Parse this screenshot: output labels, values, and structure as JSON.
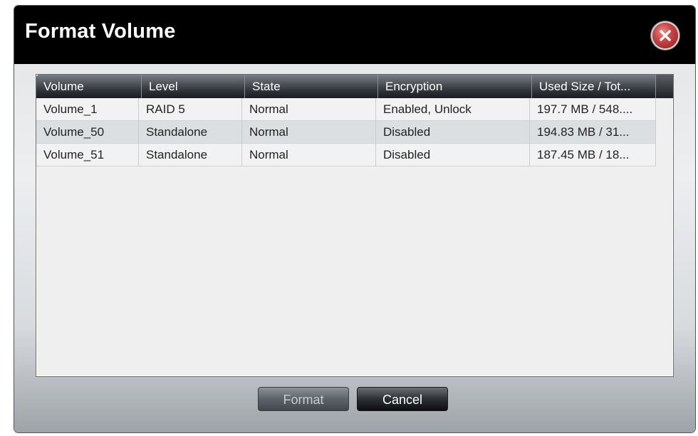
{
  "dialog": {
    "title": "Format Volume",
    "close_icon": "close-x-icon"
  },
  "table": {
    "columns": [
      "Volume",
      "Level",
      "State",
      "Encryption",
      "Used Size / Tot..."
    ],
    "rows": [
      [
        "Volume_1",
        "RAID 5",
        "Normal",
        "Enabled, Unlock",
        "197.7 MB / 548...."
      ],
      [
        "Volume_50",
        "Standalone",
        "Normal",
        "Disabled",
        "194.83 MB / 31..."
      ],
      [
        "Volume_51",
        "Standalone",
        "Normal",
        "Disabled",
        "187.45 MB / 18..."
      ]
    ]
  },
  "buttons": {
    "format_label": "Format",
    "cancel_label": "Cancel"
  },
  "colors": {
    "titlebar": "#000000",
    "close_button": "#c84545",
    "header": "#2a2d31",
    "row_alt": "#dcdfe2"
  }
}
